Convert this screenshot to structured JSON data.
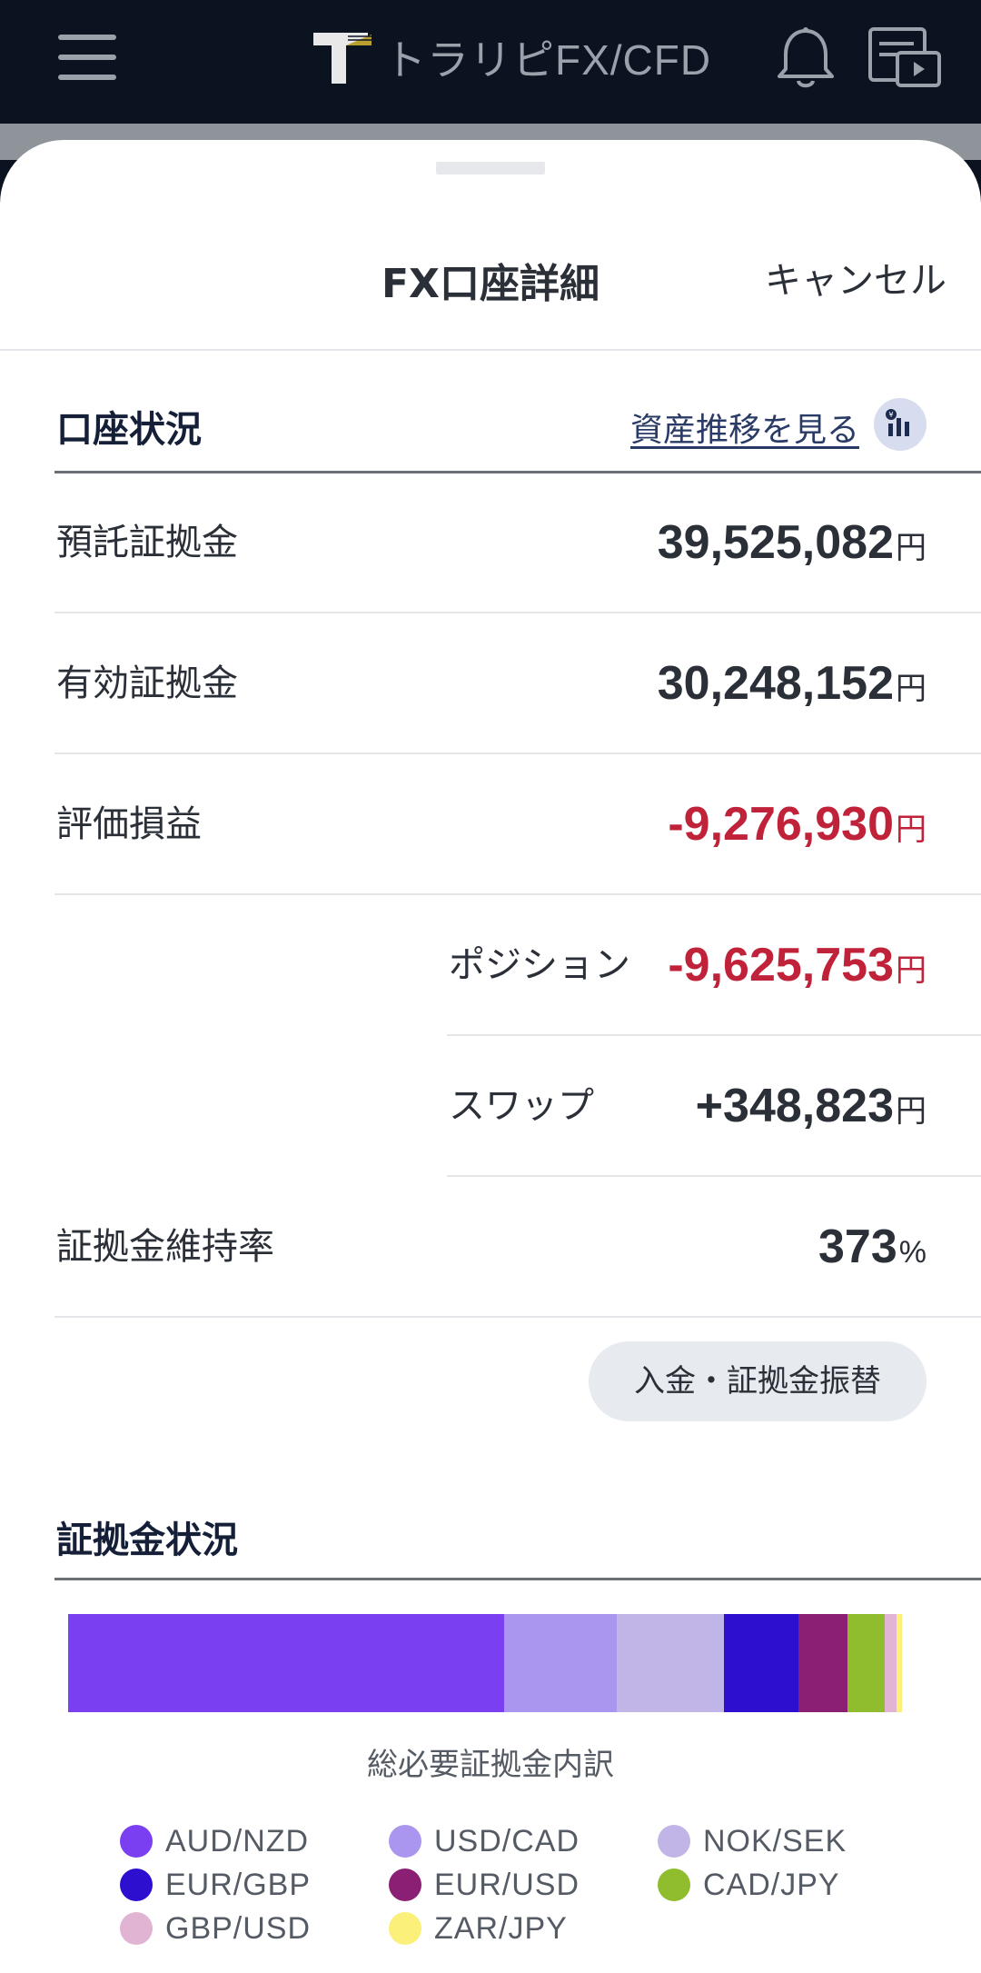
{
  "app": {
    "logo_text": "トラリピFX/CFD"
  },
  "sheet": {
    "title": "FX口座詳細",
    "cancel_label": "キャンセル"
  },
  "account": {
    "section_title": "口座状況",
    "history_link": "資産推移を見る",
    "rows": [
      {
        "label": "預託証拠金",
        "value": "39,525,082",
        "unit": "円",
        "negative": false
      },
      {
        "label": "有効証拠金",
        "value": "30,248,152",
        "unit": "円",
        "negative": false
      },
      {
        "label": "評価損益",
        "value": "-9,276,930",
        "unit": "円",
        "negative": true
      }
    ],
    "sub_rows": [
      {
        "label": "ポジション",
        "value": "-9,625,753",
        "unit": "円",
        "negative": true
      },
      {
        "label": "スワップ",
        "value": "+348,823",
        "unit": "円",
        "negative": false
      }
    ],
    "ratio": {
      "label": "証拠金維持率",
      "value": "373",
      "unit": "%"
    },
    "transfer_button": "入金・証拠金振替"
  },
  "margin": {
    "section_title": "証拠金状況",
    "caption": "総必要証拠金内訳"
  },
  "colors": {
    "negative": "#c0223a",
    "accent_bg": "#0b1220"
  },
  "chart_data": {
    "type": "bar",
    "orientation": "horizontal-stacked",
    "title": "総必要証拠金内訳",
    "unit": "percent of total",
    "series": [
      {
        "name": "AUD/NZD",
        "value": 52.3,
        "color": "#7b3ff2"
      },
      {
        "name": "USD/CAD",
        "value": 13.5,
        "color": "#ab96ef"
      },
      {
        "name": "NOK/SEK",
        "value": 12.9,
        "color": "#c0b5e6"
      },
      {
        "name": "EUR/GBP",
        "value": 8.9,
        "color": "#2d10cf"
      },
      {
        "name": "EUR/USD",
        "value": 5.9,
        "color": "#8b1f73"
      },
      {
        "name": "CAD/JPY",
        "value": 4.4,
        "color": "#90bd2e"
      },
      {
        "name": "GBP/USD",
        "value": 1.5,
        "color": "#e2b4d4"
      },
      {
        "name": "ZAR/JPY",
        "value": 0.6,
        "color": "#fbf07a"
      }
    ],
    "legend_placement": "bottom"
  }
}
